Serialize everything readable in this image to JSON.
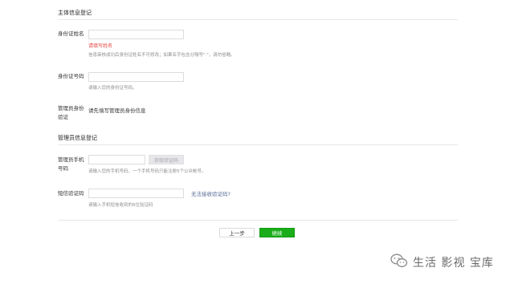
{
  "sections": {
    "entity_title": "主体信息登记",
    "admin_title": "管理员信息登记"
  },
  "id_name": {
    "label": "身份证姓名",
    "value": "",
    "error": "请填写姓名",
    "hint": "信息审核成功后身份证姓名不可修改；如果名字包含分隔号\"·\"，请勿省略。"
  },
  "id_number": {
    "label": "身份证号码",
    "value": "",
    "hint": "请输入您的身份证号码。"
  },
  "admin_id_verify": {
    "label": "管理员身份验证",
    "value": "请先填写管理员身份信息"
  },
  "admin_phone": {
    "label": "管理员手机号码",
    "value": "",
    "button": "获取验证码",
    "hint": "请输入您的手机号码，一个手机号码只能注册5个公众帐号。"
  },
  "sms_code": {
    "label": "短信验证码",
    "value": "",
    "link": "无法接收验证码?",
    "hint": "请输入手机短信收到的6位验证码"
  },
  "footer": {
    "prev_label": "上一步",
    "next_label": "继续"
  },
  "watermark": {
    "text": "生活 影视 宝库",
    "icon": "wechat-icon"
  },
  "colors": {
    "primary_green": "#1aad19",
    "error_red": "#e64340",
    "link_blue": "#576b95",
    "hint_gray": "#8d8d8d"
  }
}
